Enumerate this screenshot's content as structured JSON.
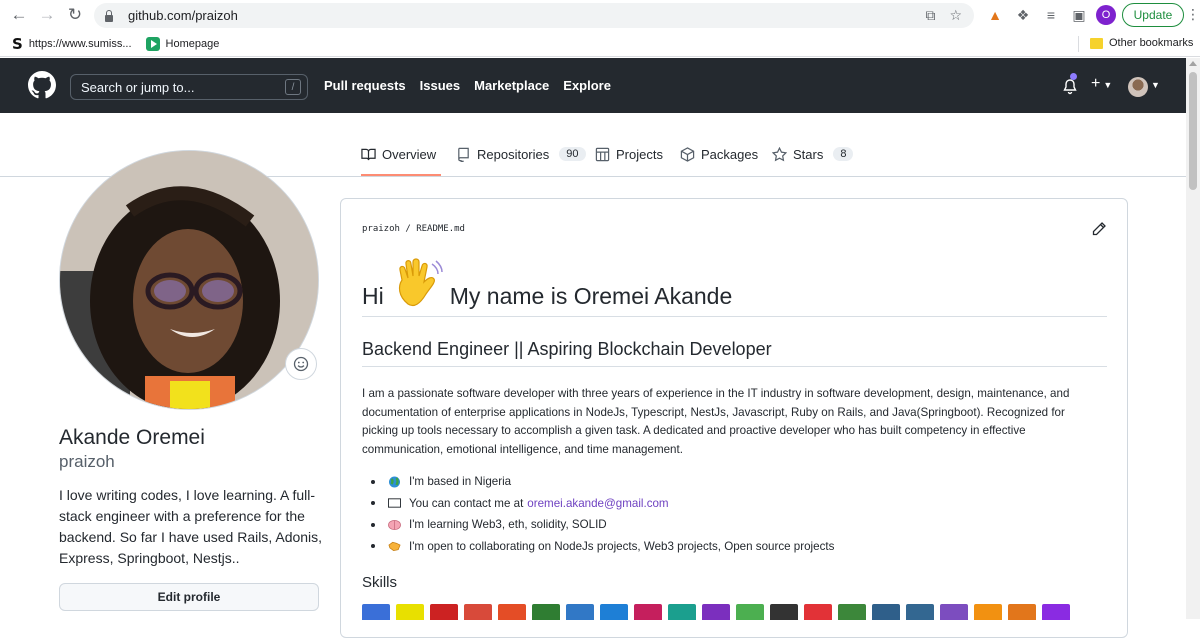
{
  "browser": {
    "url": "github.com/praizoh",
    "update_label": "Update",
    "profile_initial": "O",
    "bookmarks": [
      {
        "label": "https://www.sumiss..."
      },
      {
        "label": "Homepage"
      }
    ],
    "other_bookmarks": "Other bookmarks"
  },
  "header": {
    "search_placeholder": "Search or jump to...",
    "search_shortcut": "/",
    "nav": [
      "Pull requests",
      "Issues",
      "Marketplace",
      "Explore"
    ],
    "plus_label": "+"
  },
  "tabs": [
    {
      "label": "Overview",
      "icon": "book-icon",
      "active": true
    },
    {
      "label": "Repositories",
      "icon": "repo-icon",
      "count": "90"
    },
    {
      "label": "Projects",
      "icon": "project-icon"
    },
    {
      "label": "Packages",
      "icon": "package-icon"
    },
    {
      "label": "Stars",
      "icon": "star-icon",
      "count": "8"
    }
  ],
  "profile": {
    "name": "Akande Oremei",
    "login": "praizoh",
    "bio": "I love writing codes, I love learning. A full-stack engineer with a preference for the backend. So far I have used Rails, Adonis, Express, Springboot, Nestjs..",
    "edit_label": "Edit profile"
  },
  "readme": {
    "path_user": "praizoh",
    "path_sep": "/",
    "path_file": "README.md",
    "h1_pre": "Hi",
    "h1_post": "My name is Oremei Akande",
    "h2": "Backend Engineer || Aspiring Blockchain Developer",
    "intro": "I am a passionate software developer with three years of experience in the IT industry in software development, design, maintenance, and documentation of enterprise applications in NodeJs, Typescript, NestJs, Javascript, Ruby on Rails, and Java(Springboot). Recognized for picking up tools necessary to accomplish a given task. A dedicated and proactive developer who has built competency in effective communication, emotional intelligence, and time management.",
    "facts": [
      {
        "text": "I'm based in Nigeria",
        "icon": "globe-icon"
      },
      {
        "text": "You can contact me at",
        "link": "oremei.akande@gmail.com",
        "icon": "envelope-icon"
      },
      {
        "text": "I'm learning Web3, eth, solidity, SOLID",
        "icon": "brain-icon"
      },
      {
        "text": "I'm open to collaborating on NodeJs projects, Web3 projects, Open source projects",
        "icon": "handshake-icon"
      }
    ],
    "skills_title": "Skills",
    "skill_colors": [
      "#3a6fd8",
      "#e8e000",
      "#cc2222",
      "#d84a3a",
      "#e44d26",
      "#2f7d32",
      "#3178c6",
      "#1e7fd6",
      "#c51f5d",
      "#1b9f8e",
      "#7b2fbe",
      "#4caf50",
      "#333333",
      "#e23237",
      "#3c873a",
      "#2f5f8a",
      "#336791",
      "#7c4dbf",
      "#f29111",
      "#e2761b",
      "#8a2be2"
    ]
  }
}
